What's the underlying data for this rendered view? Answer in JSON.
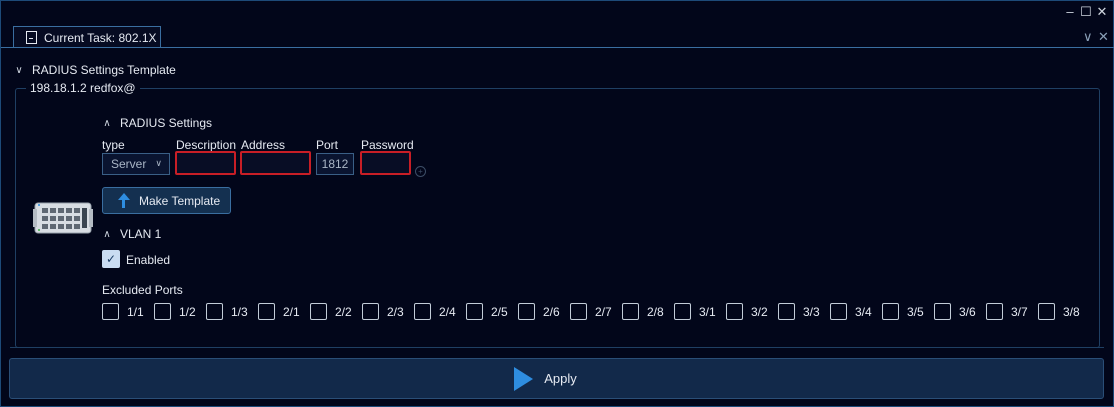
{
  "window": {
    "minimize_glyph": "–",
    "maximize_glyph": "☐",
    "close_glyph": "✕"
  },
  "tab": {
    "title": "Current Task: 802.1X",
    "icon": "document-icon",
    "overflow_glyph": "∨",
    "close_glyph": "✕"
  },
  "template_section": {
    "title": "RADIUS Settings Template",
    "chevron": "∨"
  },
  "device": {
    "label": "198.18.1.2 redfox@",
    "icon": "switch-device-icon"
  },
  "radius": {
    "title": "RADIUS Settings",
    "chevron": "∧",
    "columns": {
      "type": "type",
      "description": "Description",
      "address": "Address",
      "port": "Port",
      "password": "Password"
    },
    "type_value": "Server",
    "description_value": "",
    "address_value": "",
    "port_value": "1812",
    "password_value": "",
    "add_glyph": "+",
    "make_template_label": "Make Template"
  },
  "vlan": {
    "title": "VLAN 1",
    "chevron": "∧",
    "enabled_label": "Enabled",
    "enabled": true,
    "excluded_label": "Excluded Ports",
    "ports": [
      "1/1",
      "1/2",
      "1/3",
      "2/1",
      "2/2",
      "2/3",
      "2/4",
      "2/5",
      "2/6",
      "2/7",
      "2/8",
      "3/1",
      "3/2",
      "3/3",
      "3/4",
      "3/5",
      "3/6",
      "3/7",
      "3/8"
    ]
  },
  "apply_label": "Apply",
  "colors": {
    "background": "#02061a",
    "accent": "#2e8de0",
    "error_border": "#c81e26"
  }
}
